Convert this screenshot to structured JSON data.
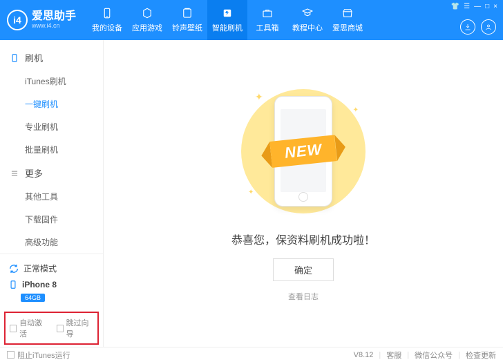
{
  "brand": {
    "name": "爱思助手",
    "url": "www.i4.cn",
    "logo_mark": "i4"
  },
  "topnav": [
    {
      "id": "device",
      "label": "我的设备"
    },
    {
      "id": "apps",
      "label": "应用游戏"
    },
    {
      "id": "ring",
      "label": "铃声壁纸"
    },
    {
      "id": "flash",
      "label": "智能刷机",
      "active": true
    },
    {
      "id": "toolbox",
      "label": "工具箱"
    },
    {
      "id": "tutorial",
      "label": "教程中心"
    },
    {
      "id": "store",
      "label": "爱思商城"
    }
  ],
  "window_controls": {
    "menu": "☰",
    "skin": "👕",
    "min": "—",
    "max": "□",
    "close": "×"
  },
  "sidebar": {
    "groups": [
      {
        "id": "flash",
        "title": "刷机",
        "items": [
          {
            "id": "itunes",
            "label": "iTunes刷机"
          },
          {
            "id": "onekey",
            "label": "一键刷机",
            "active": true
          },
          {
            "id": "pro",
            "label": "专业刷机"
          },
          {
            "id": "batch",
            "label": "批量刷机"
          }
        ]
      },
      {
        "id": "more",
        "title": "更多",
        "items": [
          {
            "id": "other",
            "label": "其他工具"
          },
          {
            "id": "firmware",
            "label": "下载固件"
          },
          {
            "id": "advanced",
            "label": "高级功能"
          }
        ]
      }
    ],
    "mode_label": "正常模式",
    "device_name": "iPhone 8",
    "storage": "64GB",
    "auto_activate": "自动激活",
    "skip_guide": "跳过向导"
  },
  "main": {
    "ribbon_text": "NEW",
    "success": "恭喜您，保资料刷机成功啦！",
    "ok": "确定",
    "view_log": "查看日志"
  },
  "footer": {
    "block_itunes": "阻止iTunes运行",
    "version": "V8.12",
    "service": "客服",
    "wechat": "微信公众号",
    "update": "检查更新"
  }
}
